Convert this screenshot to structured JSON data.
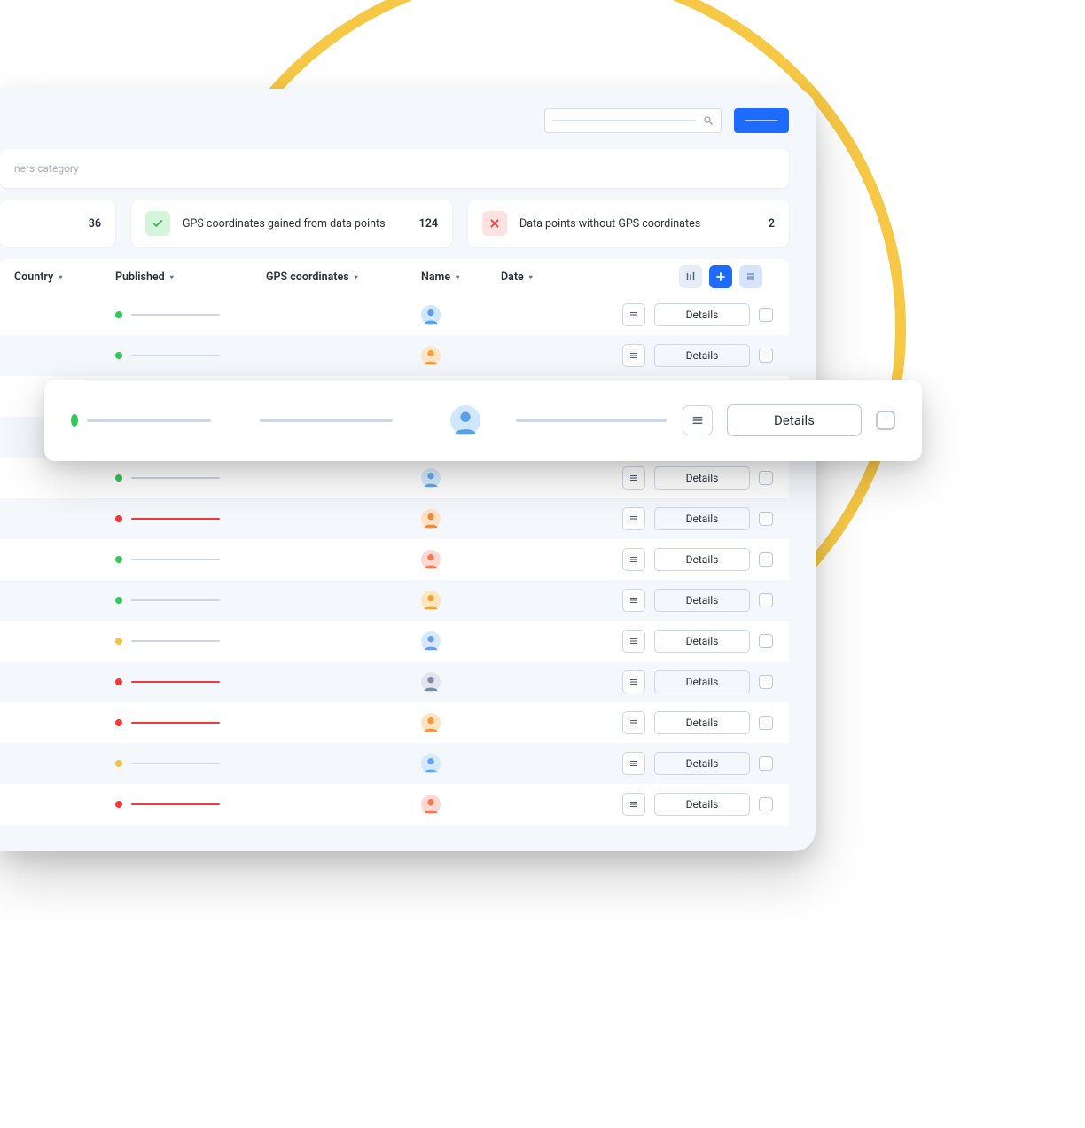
{
  "category_label": "ners category",
  "stats": {
    "first_count": "36",
    "gained_label": "GPS coordinates gained from data points",
    "gained_count": "124",
    "without_label": "Data points without GPS  coordinates",
    "without_count": "2"
  },
  "columns": {
    "country": "Country",
    "published": "Published",
    "gps": "GPS coordinates",
    "name": "Name",
    "date": "Date"
  },
  "details_label": "Details",
  "float_row": {
    "status": "green",
    "details_label": "Details",
    "avatar_bg": "#cfe7ff",
    "avatar_fg": "#5aa0e8"
  },
  "rows": [
    {
      "status": "green",
      "gps_red": false,
      "pub_red": false,
      "avatar_bg": "#cfe7ff",
      "avatar_fg": "#5aa0e8"
    },
    {
      "status": "green",
      "gps_red": false,
      "pub_red": false,
      "avatar_bg": "#ffe6c9",
      "avatar_fg": "#f29e3b"
    },
    {
      "status": "yellow",
      "gps_red": false,
      "pub_red": false,
      "avatar_bg": "#ffd9e7",
      "avatar_fg": "#e86aa0"
    },
    {
      "status": "red",
      "gps_red": true,
      "pub_red": true,
      "avatar_bg": "#ffe6c9",
      "avatar_fg": "#f2a23b"
    },
    {
      "status": "green",
      "gps_red": false,
      "pub_red": false,
      "avatar_bg": "#d8ecff",
      "avatar_fg": "#6aa8e8"
    },
    {
      "status": "red",
      "gps_red": true,
      "pub_red": true,
      "avatar_bg": "#ffe1c7",
      "avatar_fg": "#f08a3a"
    },
    {
      "status": "green",
      "gps_red": false,
      "pub_red": false,
      "avatar_bg": "#ffd9d0",
      "avatar_fg": "#f07a55"
    },
    {
      "status": "green",
      "gps_red": false,
      "pub_red": false,
      "avatar_bg": "#ffe4c0",
      "avatar_fg": "#f0a23a"
    },
    {
      "status": "yellow",
      "gps_red": false,
      "pub_red": false,
      "avatar_bg": "#d7e9ff",
      "avatar_fg": "#6a9de8"
    },
    {
      "status": "red",
      "gps_red": true,
      "pub_red": true,
      "avatar_bg": "#e1e5ee",
      "avatar_fg": "#7d8aa0"
    },
    {
      "status": "red",
      "gps_red": true,
      "pub_red": true,
      "avatar_bg": "#ffe3c2",
      "avatar_fg": "#f29a3a"
    },
    {
      "status": "yellow",
      "gps_red": false,
      "pub_red": false,
      "avatar_bg": "#d6e9ff",
      "avatar_fg": "#5fa3f2"
    },
    {
      "status": "red",
      "gps_red": true,
      "pub_red": true,
      "avatar_bg": "#ffd8d0",
      "avatar_fg": "#f2775a"
    }
  ]
}
